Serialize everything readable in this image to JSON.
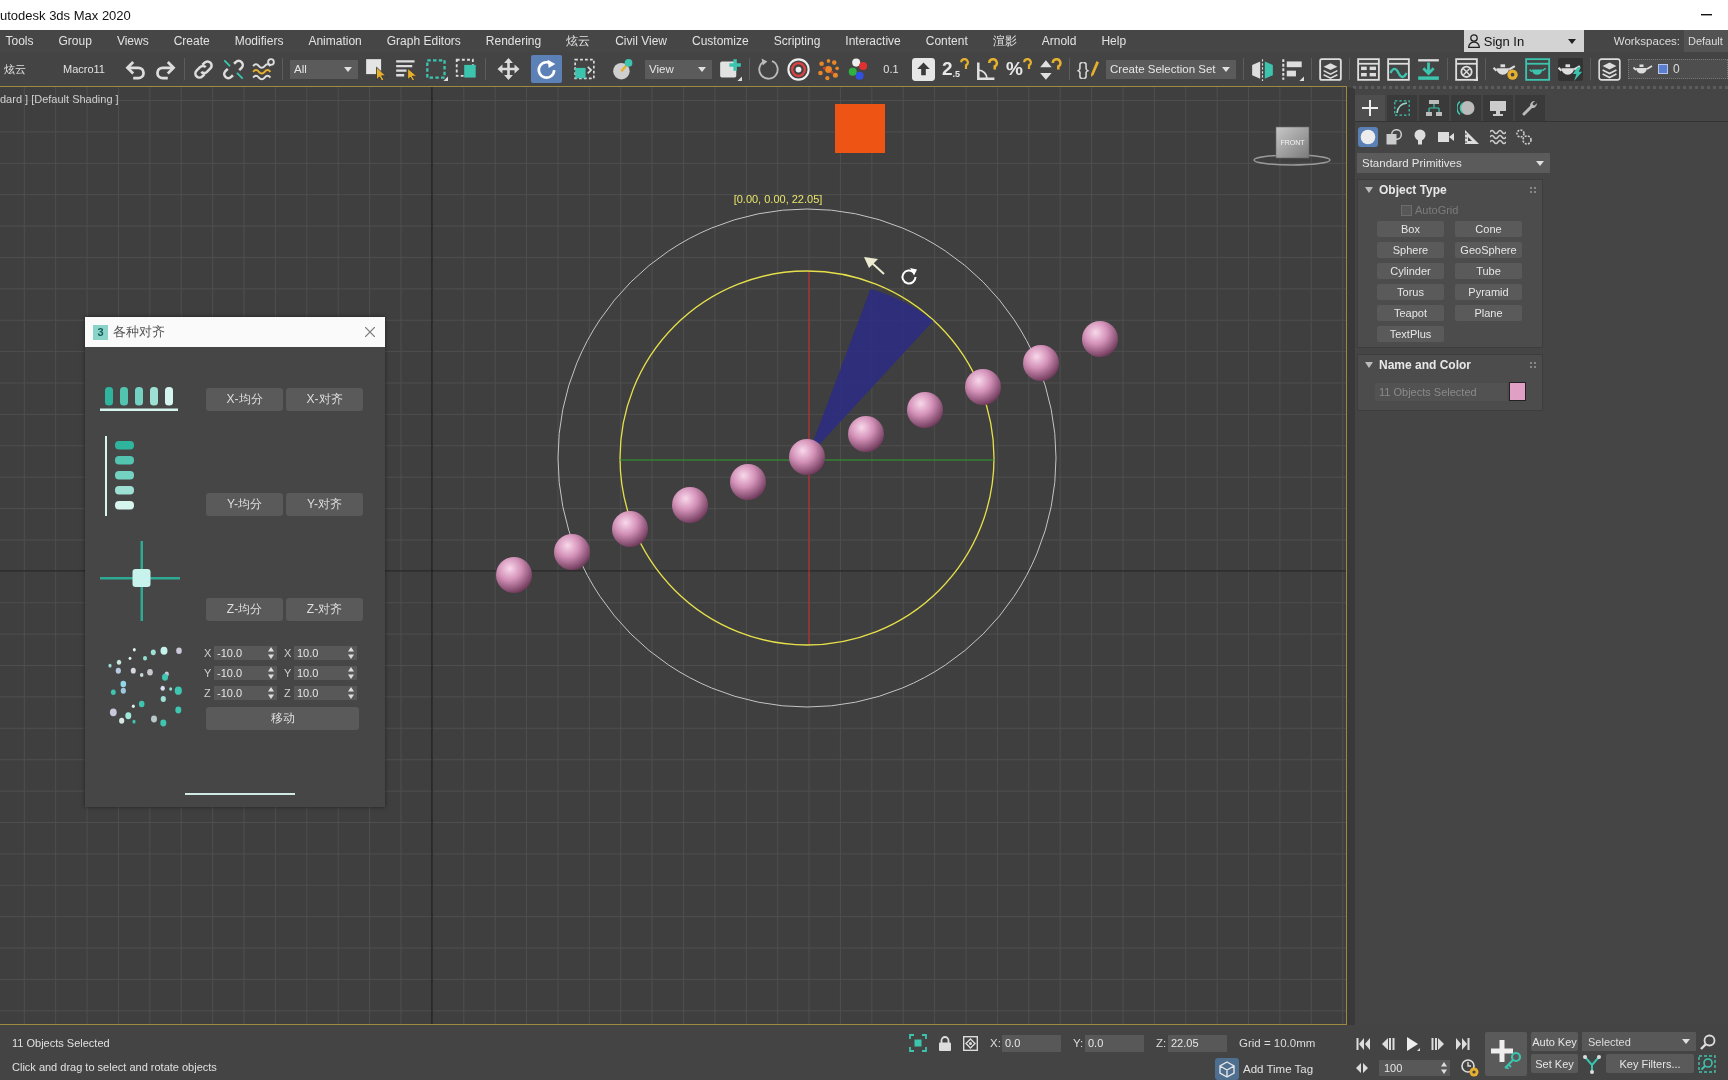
{
  "window": {
    "title": "utodesk 3ds Max 2020"
  },
  "menu_bar": {
    "items": [
      "Tools",
      "Group",
      "Views",
      "Create",
      "Modifiers",
      "Animation",
      "Graph Editors",
      "Rendering",
      "炫云",
      "Civil View",
      "Customize",
      "Scripting",
      "Interactive",
      "Content",
      "渲影",
      "Arnold",
      "Help"
    ],
    "sign_in": "Sign In",
    "workspaces_label": "Workspaces:",
    "workspace": "Default"
  },
  "main_toolbar": {
    "labels": [
      "炫云",
      "Macro11",
      "0.1"
    ],
    "selection_filter": "All",
    "transform_tools": [
      {
        "selected": false
      },
      {
        "selected": true
      },
      {
        "selected": false
      },
      {
        "selected": false
      }
    ],
    "reference_coordinate_system": "View",
    "snap_toggle": "2$_{.5}$",
    "percent_snap": "%",
    "named_selection_sets": "{}",
    "selection_set": "Create Selection Set",
    "layer": "0"
  },
  "viewport": {
    "label": "dard ] [Default Shading ]",
    "coordinate_readout": "[0.00, 0.00, 22.05]",
    "viewcube_face": "FRONT"
  },
  "dialog": {
    "logo": "3",
    "title": "各种对齐",
    "button_rows": [
      [
        "X-均分",
        "X-对齐"
      ],
      [
        "Y-均分",
        "Y-对齐"
      ],
      [
        "Z-均分",
        "Z-对齐"
      ]
    ],
    "offset_rows": [
      [
        {
          "label": "X",
          "value": "-10.0"
        },
        {
          "label": "X",
          "value": "10.0"
        }
      ],
      [
        {
          "label": "Y",
          "value": "-10.0"
        },
        {
          "label": "Y",
          "value": "10.0"
        }
      ],
      [
        {
          "label": "Z",
          "value": "-10.0"
        },
        {
          "label": "Z",
          "value": "10.0"
        }
      ]
    ],
    "move_button": "移动"
  },
  "command_panel": {
    "tabs": [
      {
        "selected": true
      },
      {
        "selected": false
      },
      {
        "selected": false
      },
      {
        "selected": false
      },
      {
        "selected": false
      },
      {
        "selected": false
      }
    ],
    "categories": [
      {
        "selected": true
      },
      {
        "selected": false
      },
      {
        "selected": false
      },
      {
        "selected": false
      },
      {
        "selected": false
      },
      {
        "selected": false
      },
      {
        "selected": false
      }
    ],
    "object_category": "Standard Primitives",
    "rollouts": [
      {
        "kind": "object_type",
        "title": "Object Type",
        "expanded": true,
        "autogrid": {
          "label": "AutoGrid",
          "checked": false,
          "disabled": true
        },
        "buttons": [
          "Box",
          "Cone",
          "Sphere",
          "GeoSphere",
          "Cylinder",
          "Tube",
          "Torus",
          "Pyramid",
          "Teapot",
          "Plane",
          "TextPlus"
        ]
      },
      {
        "kind": "name_and_color",
        "title": "Name and Color",
        "expanded": true,
        "name_field": {
          "value": "11 Objects Selected",
          "disabled": true
        }
      }
    ]
  },
  "status_bar": {
    "selection": "11 Objects Selected",
    "prompt": "Click and drag to select and rotate objects",
    "coordinates": [
      {
        "label": "X:",
        "value": "0.0"
      },
      {
        "label": "Y:",
        "value": "0.0"
      },
      {
        "label": "Z:",
        "value": "22.05"
      }
    ],
    "grid": "Grid = 10.0mm",
    "time_tag": "Add Time Tag",
    "current_frame": "100",
    "auto_key": "Auto Key",
    "key_mode": "Selected",
    "set_key": "Set Key",
    "key_filters": "Key Filters..."
  }
}
